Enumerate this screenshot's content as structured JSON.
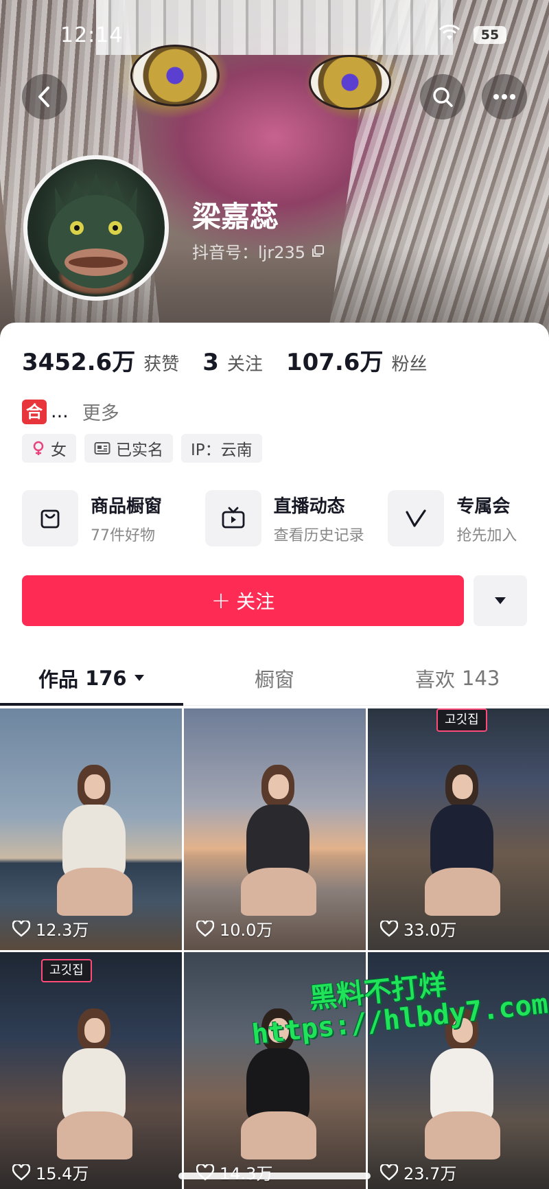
{
  "status_bar": {
    "time": "12:14",
    "battery": "55"
  },
  "profile": {
    "name": "梁嘉蕊",
    "douyin_id": "抖音号：ljr235",
    "stats": [
      {
        "value": "3452.6万",
        "label": "获赞"
      },
      {
        "value": "3",
        "label": "关注"
      },
      {
        "value": "107.6万",
        "label": "粉丝"
      }
    ],
    "bio_emoji": "合",
    "bio_ellipsis": "...",
    "bio_more": "更多",
    "tags": [
      {
        "icon": "female-icon",
        "label": "女"
      },
      {
        "icon": "id-card-icon",
        "label": "已实名"
      },
      {
        "icon": "",
        "label": "IP：云南"
      }
    ]
  },
  "shortcuts": [
    {
      "icon": "shopping-bag-icon",
      "title": "商品橱窗",
      "subtitle": "77件好物"
    },
    {
      "icon": "tv-icon",
      "title": "直播动态",
      "subtitle": "查看历史记录"
    },
    {
      "icon": "v-icon",
      "title": "专属会",
      "subtitle": "抢先加入"
    }
  ],
  "actions": {
    "follow_label": "关注",
    "follow_plus": "+"
  },
  "tabs": [
    {
      "label": "作品",
      "count": "176",
      "active": true
    },
    {
      "label": "橱窗",
      "count": "",
      "active": false
    },
    {
      "label": "喜欢",
      "count": "143",
      "active": false
    }
  ],
  "videos": [
    {
      "likes": "12.3万"
    },
    {
      "likes": "10.0万"
    },
    {
      "likes": "33.0万"
    },
    {
      "likes": "15.4万"
    },
    {
      "likes": "14.3万"
    },
    {
      "likes": "23.7万"
    }
  ],
  "watermark": {
    "line1": "黑料不打烊",
    "line2": "https://hlbdy7.com"
  },
  "colors": {
    "accent": "#fe2c55",
    "text": "#161823",
    "watermark": "#21e35a"
  }
}
